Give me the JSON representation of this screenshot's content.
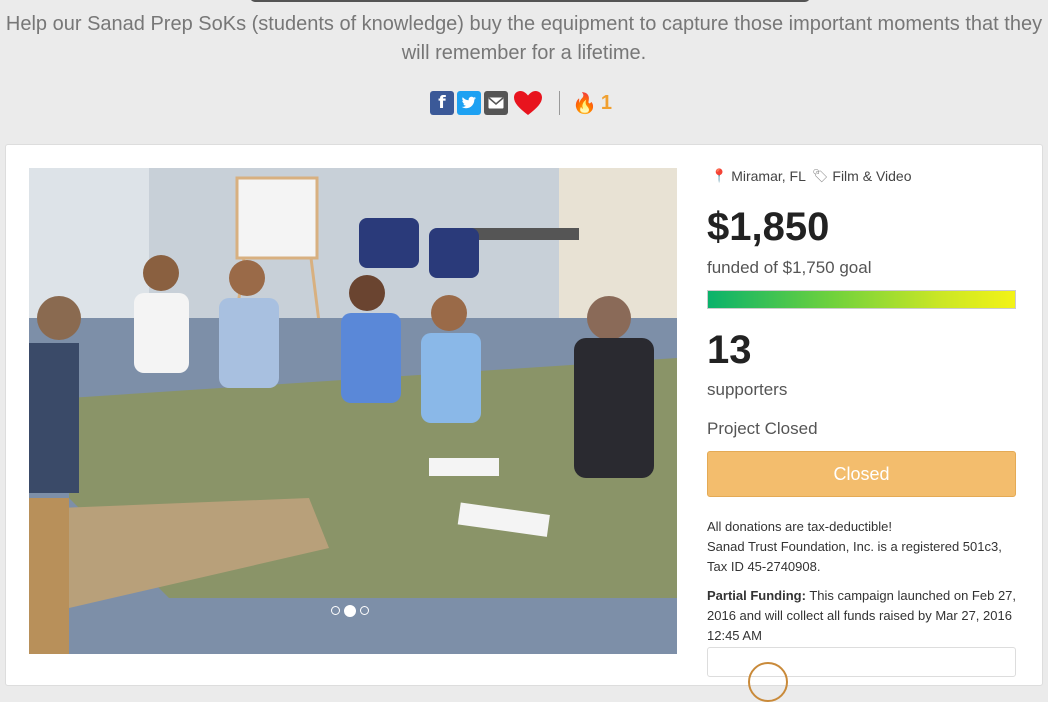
{
  "header": {
    "tagline": "Help our Sanad Prep SoKs (students of knowledge) buy the equipment to capture those important moments that they will remember for a lifetime."
  },
  "share": {
    "icons": [
      "facebook-icon",
      "twitter-icon",
      "email-icon",
      "heart-icon"
    ],
    "fire_count": "1",
    "colors": {
      "facebook": "#3b5998",
      "twitter": "#1da1f2",
      "email": "#555555",
      "heart": "#e8141e",
      "fire": "#f0a030"
    }
  },
  "carousel": {
    "slide_count": 3,
    "active_index": 1
  },
  "campaign": {
    "location": "Miramar, FL",
    "category": "Film & Video",
    "amount": "$1,850",
    "goal_text": "funded of $1,750 goal",
    "progress_fraction": 1.0,
    "supporters_count": "13",
    "supporters_label": "supporters",
    "status": "Project Closed",
    "button_label": "Closed",
    "button_color": "#f3bd6d",
    "tax_line1": "All donations are tax-deductible!",
    "tax_line2": "Sanad Trust Foundation, Inc. is a registered 501c3, Tax ID 45-2740908.",
    "partial_label": "Partial Funding:",
    "partial_text": " This campaign launched on Feb 27, 2016 and will collect all funds raised by Mar 27, 2016 12:45 AM"
  }
}
